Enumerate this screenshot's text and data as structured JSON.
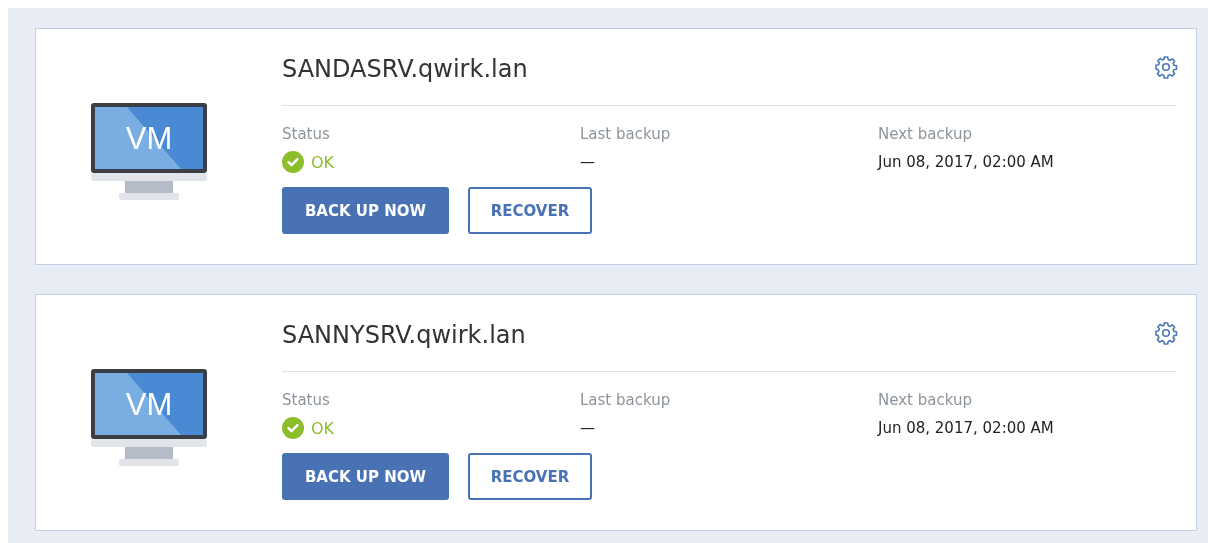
{
  "machines": [
    {
      "name": "SANDASRV.qwirk.lan",
      "badge": "VM",
      "fields": [
        {
          "label": "Status",
          "value": "OK",
          "kind": "status",
          "color": "#8cbd2b"
        },
        {
          "label": "Last backup",
          "value": "—",
          "kind": "text"
        },
        {
          "label": "Next backup",
          "value": "Jun 08, 2017, 02:00 AM",
          "kind": "text"
        }
      ],
      "buttons": [
        {
          "label": "BACK UP NOW",
          "kind": "primary"
        },
        {
          "label": "RECOVER",
          "kind": "secondary"
        }
      ]
    },
    {
      "name": "SANNYSRV.qwirk.lan",
      "badge": "VM",
      "fields": [
        {
          "label": "Status",
          "value": "OK",
          "kind": "status",
          "color": "#8cbd2b"
        },
        {
          "label": "Last backup",
          "value": "—",
          "kind": "text"
        },
        {
          "label": "Next backup",
          "value": "Jun 08, 2017, 02:00 AM",
          "kind": "text"
        }
      ],
      "buttons": [
        {
          "label": "BACK UP NOW",
          "kind": "primary"
        },
        {
          "label": "RECOVER",
          "kind": "secondary"
        }
      ]
    }
  ]
}
